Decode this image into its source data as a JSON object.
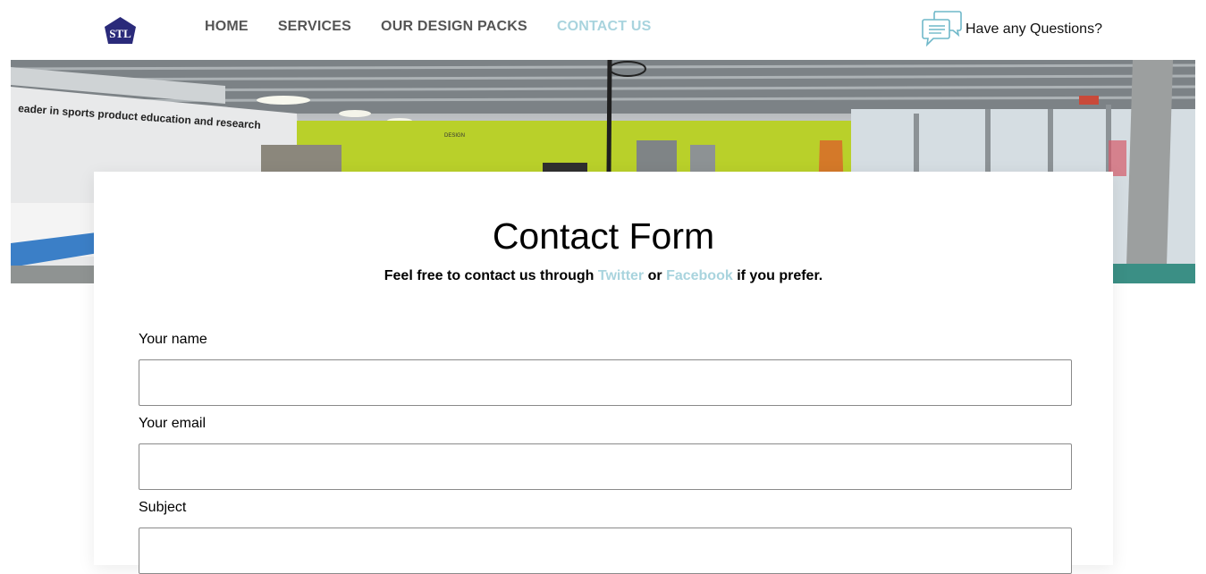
{
  "header": {
    "logo_text": "STL",
    "nav": [
      {
        "label": "HOME",
        "active": false
      },
      {
        "label": "SERVICES",
        "active": false
      },
      {
        "label": "OUR DESIGN PACKS",
        "active": false
      },
      {
        "label": "CONTACT US",
        "active": true
      }
    ],
    "questions_label": "Have any Questions?",
    "questions_icon": "chat-bubbles-icon"
  },
  "hero": {
    "wall_text": "eader in sports product education and research",
    "sign_text": "DESIGN"
  },
  "form": {
    "title": "Contact Form",
    "subtitle_before": "Feel free to contact us through",
    "twitter_label": "Twitter",
    "subtitle_or": "or",
    "facebook_label": "Facebook",
    "subtitle_after": "if you prefer.",
    "fields": [
      {
        "label": "Your name",
        "value": ""
      },
      {
        "label": "Your email",
        "value": ""
      },
      {
        "label": "Subject",
        "value": ""
      }
    ]
  },
  "colors": {
    "accent": "#a9d4de",
    "nav_text": "#555555",
    "logo_fill": "#2a2a7a"
  }
}
